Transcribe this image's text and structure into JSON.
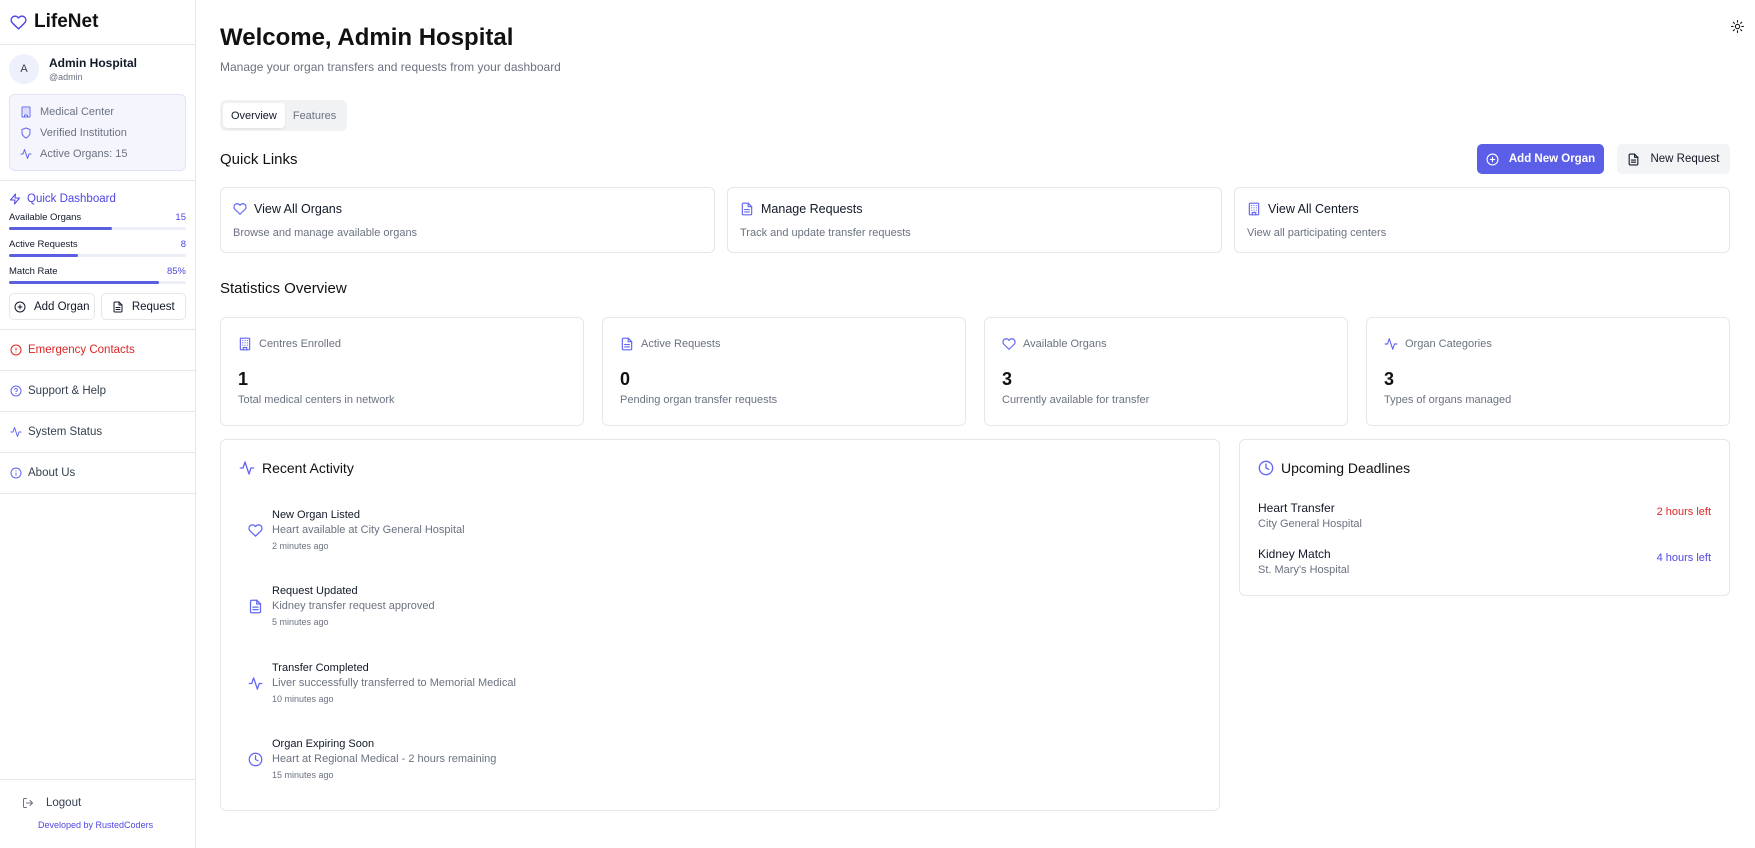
{
  "colors": {
    "accent": "#5b5fe8",
    "danger": "#dc2626",
    "muted": "#6b7280",
    "border": "#e5e7eb"
  },
  "brand": {
    "name": "LifeNet",
    "icon": "heart-icon"
  },
  "profile": {
    "initial": "A",
    "name": "Admin Hospital",
    "username": "@admin"
  },
  "info": {
    "type": "Medical Center",
    "verified": "Verified Institution",
    "organs": "Active Organs: 15"
  },
  "quick_dashboard": {
    "title": "Quick Dashboard",
    "stats": [
      {
        "label": "Available Organs",
        "value": "15",
        "fill": 0.58
      },
      {
        "label": "Active Requests",
        "value": "8",
        "fill": 0.39
      },
      {
        "label": "Match Rate",
        "value": "85%",
        "fill": 0.85
      }
    ],
    "add_organ": "Add Organ",
    "request": "Request"
  },
  "nav": {
    "emergency": "Emergency Contacts",
    "support": "Support & Help",
    "status": "System Status",
    "about": "About Us"
  },
  "logout": "Logout",
  "developed_by": "Developed by RustedCoders",
  "header": {
    "title": "Welcome, Admin Hospital",
    "subtitle": "Manage your organ transfers and requests from your dashboard"
  },
  "tabs": {
    "overview": "Overview",
    "features": "Features"
  },
  "quick_links": {
    "title": "Quick Links",
    "add_new_organ": "Add New Organ",
    "new_request": "New Request",
    "items": [
      {
        "title": "View All Organs",
        "desc": "Browse and manage available organs",
        "icon": "heart-icon"
      },
      {
        "title": "Manage Requests",
        "desc": "Track and update transfer requests",
        "icon": "document-icon"
      },
      {
        "title": "View All Centers",
        "desc": "View all participating centers",
        "icon": "building-icon"
      }
    ]
  },
  "statistics": {
    "title": "Statistics Overview",
    "items": [
      {
        "label": "Centres Enrolled",
        "value": "1",
        "desc": "Total medical centers in network",
        "icon": "building-icon"
      },
      {
        "label": "Active Requests",
        "value": "0",
        "desc": "Pending organ transfer requests",
        "icon": "document-icon"
      },
      {
        "label": "Available Organs",
        "value": "3",
        "desc": "Currently available for transfer",
        "icon": "heart-icon"
      },
      {
        "label": "Organ Categories",
        "value": "3",
        "desc": "Types of organs managed",
        "icon": "activity-icon"
      }
    ]
  },
  "recent_activity": {
    "title": "Recent Activity",
    "items": [
      {
        "title": "New Organ Listed",
        "desc": "Heart available at City General Hospital",
        "when": "2 minutes ago",
        "icon": "heart-icon"
      },
      {
        "title": "Request Updated",
        "desc": "Kidney transfer request approved",
        "when": "5 minutes ago",
        "icon": "document-icon"
      },
      {
        "title": "Transfer Completed",
        "desc": "Liver successfully transferred to Memorial Medical",
        "when": "10 minutes ago",
        "icon": "activity-icon"
      },
      {
        "title": "Organ Expiring Soon",
        "desc": "Heart at Regional Medical - 2 hours remaining",
        "when": "15 minutes ago",
        "icon": "clock-icon"
      }
    ]
  },
  "deadlines": {
    "title": "Upcoming Deadlines",
    "items": [
      {
        "title": "Heart Transfer",
        "place": "City General Hospital",
        "left": "2 hours left",
        "color": "#dc2626"
      },
      {
        "title": "Kidney Match",
        "place": "St. Mary's Hospital",
        "left": "4 hours left",
        "color": "#4f46e5"
      }
    ]
  }
}
